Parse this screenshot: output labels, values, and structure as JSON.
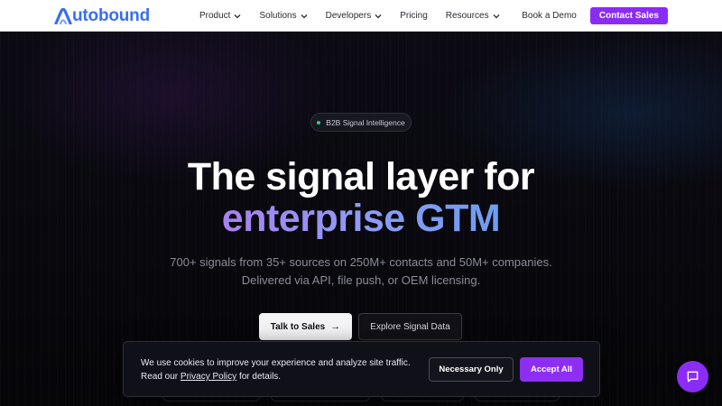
{
  "brand": {
    "name": "utobound",
    "logo_icon": "autobound-logo-icon",
    "color": "#3b6ef0"
  },
  "nav": {
    "items": [
      {
        "label": "Product",
        "dropdown": true
      },
      {
        "label": "Solutions",
        "dropdown": true
      },
      {
        "label": "Developers",
        "dropdown": true
      },
      {
        "label": "Pricing",
        "dropdown": false
      },
      {
        "label": "Resources",
        "dropdown": true
      }
    ],
    "book_demo": "Book a Demo",
    "contact_sales": "Contact Sales"
  },
  "hero": {
    "badge": "B2B Signal Intelligence",
    "headline_line1": "The signal layer for",
    "headline_line2": "enterprise GTM",
    "subtitle_line1": "700+ signals from 35+ sources on 250M+ contacts and 50M+ companies.",
    "subtitle_line2": "Delivered via API, file push, or OEM licensing.",
    "cta_primary": "Talk to Sales",
    "cta_primary_icon": "arrow-right-icon",
    "cta_secondary": "Explore Signal Data"
  },
  "cookie_banner": {
    "text_before_link": "We use cookies to improve your experience and analyze site traffic. Read our ",
    "link_text": "Privacy Policy",
    "text_after_link": " for details.",
    "necessary_button": "Necessary Only",
    "accept_button": "Accept All"
  },
  "chat": {
    "icon": "chat-bubble-icon"
  },
  "colors": {
    "accent": "#8b2cf5",
    "badge_dot": "#2ed08a",
    "background": "#07070c"
  }
}
